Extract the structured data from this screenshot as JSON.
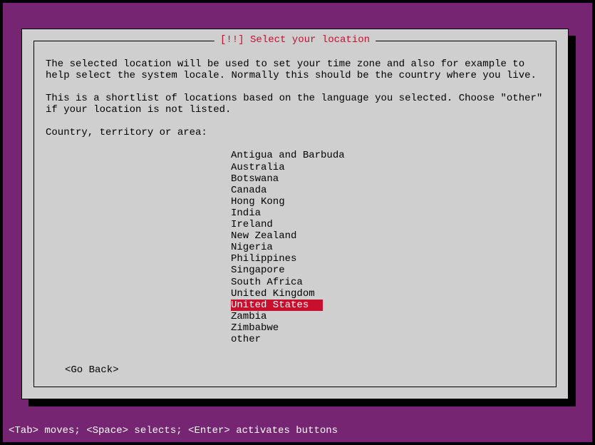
{
  "dialog": {
    "title": "[!!] Select your location",
    "helpText1": "The selected location will be used to set your time zone and also for example to help select the system locale. Normally this should be the country where you live.",
    "helpText2": "This is a shortlist of locations based on the language you selected. Choose \"other\" if your location is not listed.",
    "promptLabel": "Country, territory or area:",
    "locations": [
      "Antigua and Barbuda",
      "Australia",
      "Botswana",
      "Canada",
      "Hong Kong",
      "India",
      "Ireland",
      "New Zealand",
      "Nigeria",
      "Philippines",
      "Singapore",
      "South Africa",
      "United Kingdom",
      "United States",
      "Zambia",
      "Zimbabwe",
      "other"
    ],
    "selectedIndex": 13,
    "goBackLabel": "<Go Back>"
  },
  "statusBar": "<Tab> moves; <Space> selects; <Enter> activates buttons"
}
